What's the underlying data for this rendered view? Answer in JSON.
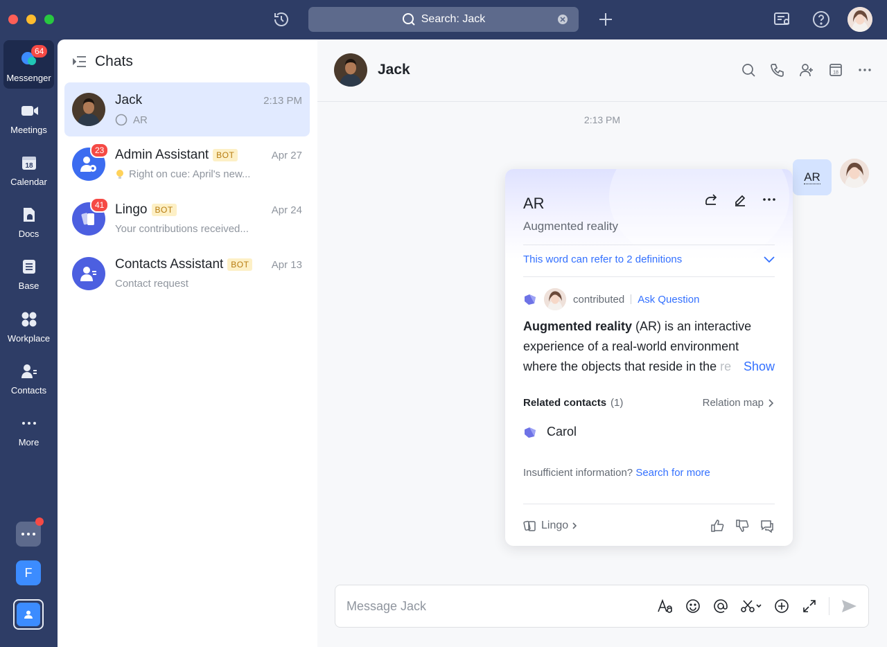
{
  "titlebar": {
    "search_label": "Search: Jack"
  },
  "rail": {
    "items": [
      {
        "label": "Messenger",
        "badge": "64"
      },
      {
        "label": "Meetings"
      },
      {
        "label": "Calendar",
        "date": "18"
      },
      {
        "label": "Docs"
      },
      {
        "label": "Base"
      },
      {
        "label": "Workplace"
      },
      {
        "label": "Contacts"
      },
      {
        "label": "More"
      }
    ],
    "workspace_letter": "F"
  },
  "chatlist": {
    "title": "Chats",
    "items": [
      {
        "name": "Jack",
        "time": "2:13 PM",
        "preview": "AR"
      },
      {
        "name": "Admin Assistant",
        "bot": "BOT",
        "time": "Apr 27",
        "preview": "Right on cue: April's new...",
        "badge": "23"
      },
      {
        "name": "Lingo",
        "bot": "BOT",
        "time": "Apr 24",
        "preview": "Your contributions received...",
        "badge": "41"
      },
      {
        "name": "Contacts Assistant",
        "bot": "BOT",
        "time": "Apr 13",
        "preview": "Contact request"
      }
    ]
  },
  "conversation": {
    "name": "Jack",
    "time_divider": "2:13 PM",
    "message": "AR",
    "calendar_date": "18",
    "composer_placeholder": "Message Jack"
  },
  "card": {
    "title": "AR",
    "subtitle": "Augmented reality",
    "definitions_text": "This word can refer to 2 definitions",
    "contributed": "contributed",
    "ask_question": "Ask Question",
    "body_bold": "Augmented reality",
    "body_rest": " (AR) is an interactive experience of a real-world environment where the objects that reside in the ",
    "body_fade": "re",
    "show": "Show",
    "related_title": "Related contacts",
    "related_count": "(1)",
    "relation_map": "Relation map",
    "contact_name": "Carol",
    "insufficient": "Insufficient information?",
    "search_more": "Search for more",
    "footer_source": "Lingo"
  }
}
